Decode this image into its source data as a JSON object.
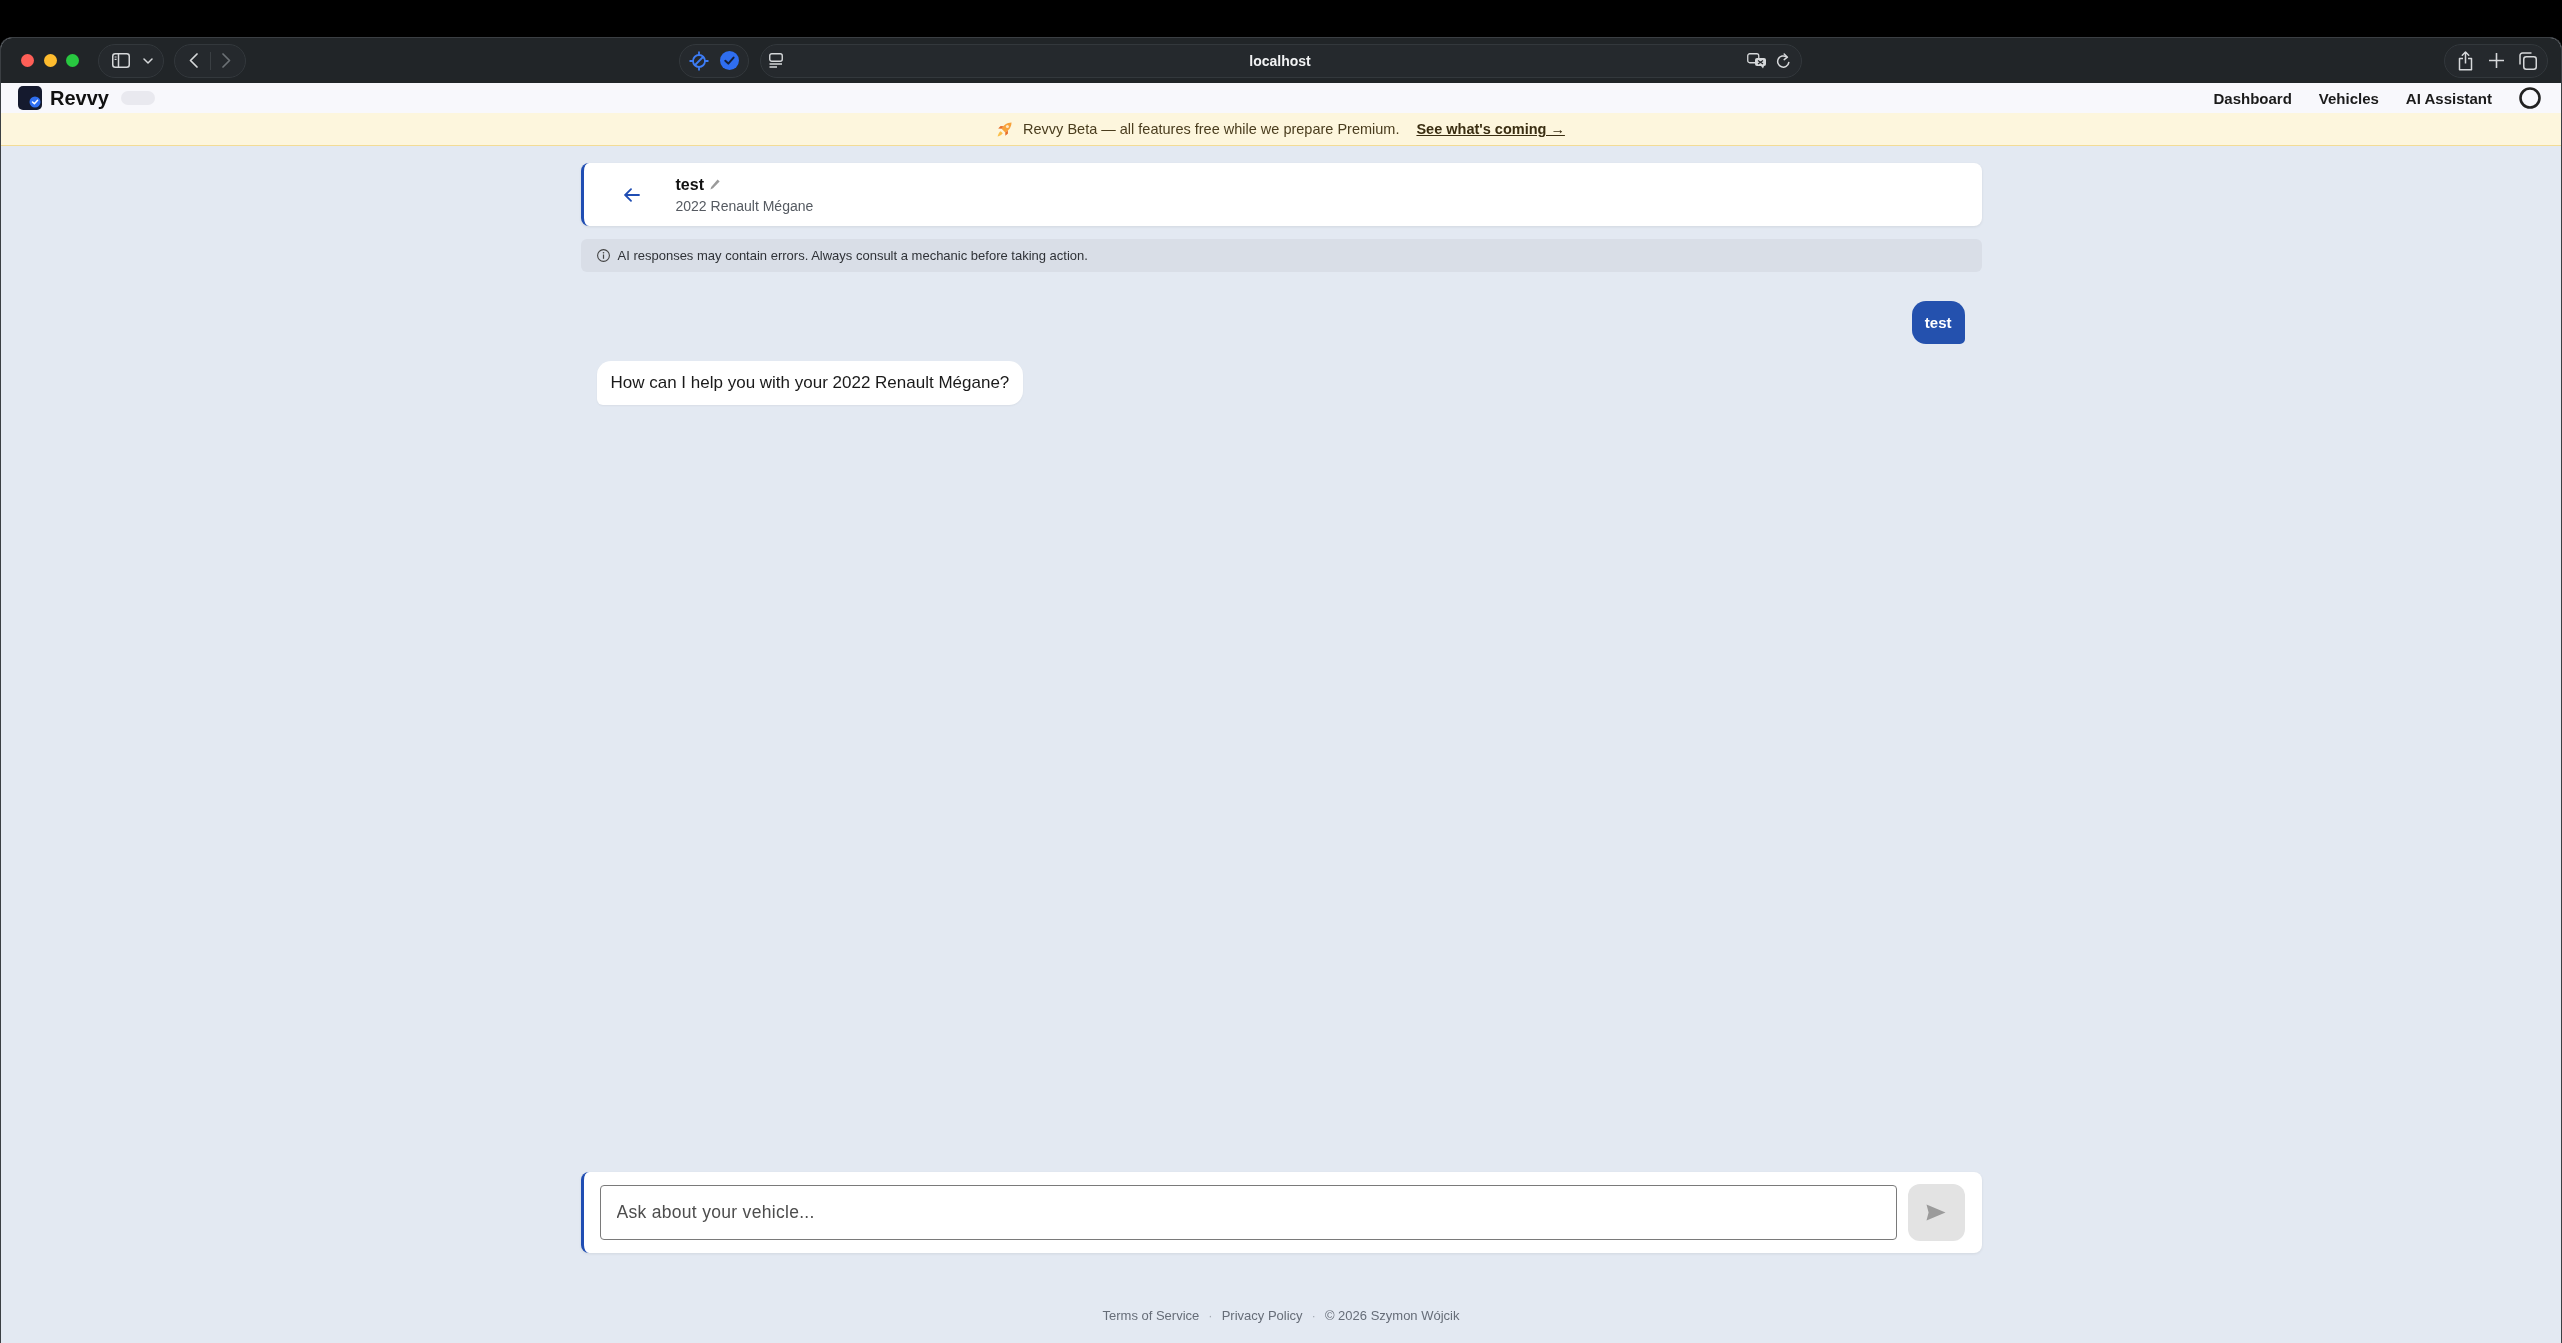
{
  "browser": {
    "url": "localhost",
    "forward_disabled": true
  },
  "nav": {
    "brand": "Revvy",
    "links": [
      "Dashboard",
      "Vehicles",
      "AI Assistant"
    ]
  },
  "banner": {
    "text": "Revvy Beta — all features free while we prepare Premium.",
    "link": "See what's coming →"
  },
  "chat_header": {
    "title": "test",
    "subtitle": "2022 Renault Mégane"
  },
  "disclaimer": "AI responses may contain errors. Always consult a mechanic before taking action.",
  "messages": [
    {
      "kind": "user",
      "text": "test"
    },
    {
      "kind": "assistant",
      "text": "How can I help you with your 2022 Renault Mégane?"
    }
  ],
  "composer": {
    "placeholder": "Ask about your vehicle...",
    "send_disabled": true
  },
  "footer": [
    {
      "kind": "link",
      "text": "Terms of Service"
    },
    {
      "kind": "separator",
      "text": "·"
    },
    {
      "kind": "link",
      "text": "Privacy Policy"
    },
    {
      "kind": "separator",
      "text": "·"
    },
    {
      "kind": "text",
      "text": "© 2026 Szymon Wójcik"
    }
  ]
}
